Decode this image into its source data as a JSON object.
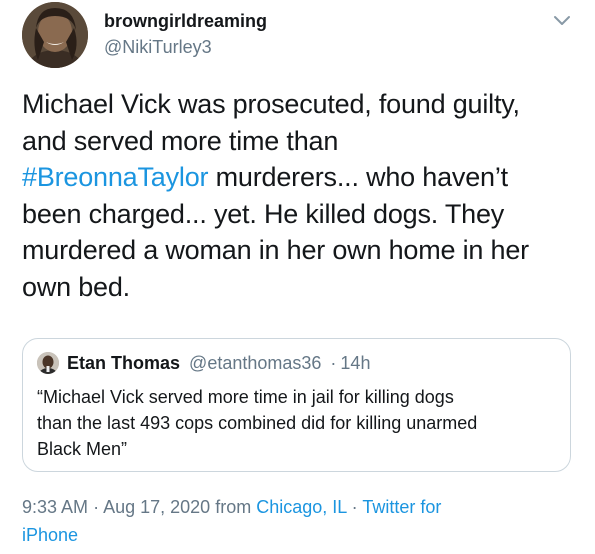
{
  "author": {
    "display_name": "browngirldreaming",
    "handle": "@NikiTurley3",
    "avatar_icon": "profile-photo"
  },
  "menu_icon": "chevron-down-icon",
  "tweet": {
    "lines": [
      [
        "Michael Vick was prosecuted, found guilty,"
      ],
      [
        "and served more time than"
      ],
      [
        "#BreonnaTaylor",
        " murderers... who haven’t"
      ],
      [
        "been charged... yet. He killed dogs. They"
      ],
      [
        "murdered a woman in her own home in her"
      ],
      [
        "own bed."
      ]
    ],
    "hashtag": "#BreonnaTaylor"
  },
  "quote": {
    "name": "Etan Thomas",
    "handle": "@etanthomas36",
    "separator": "·",
    "time": "14h",
    "text_lines": [
      "“Michael Vick served more time in jail for killing dogs",
      "than the last 493 cops combined did for killing unarmed",
      "Black Men”"
    ]
  },
  "meta": {
    "time": "9:33 AM",
    "sep1": "·",
    "date": "Aug 17, 2020",
    "from": "from",
    "location": "Chicago, IL",
    "sep2": "·",
    "client_line1": "Twitter for",
    "client_line2": "iPhone"
  },
  "colors": {
    "link": "#1b95e0",
    "secondary": "#657786",
    "text": "#14171a",
    "border": "#ccd6dd"
  }
}
